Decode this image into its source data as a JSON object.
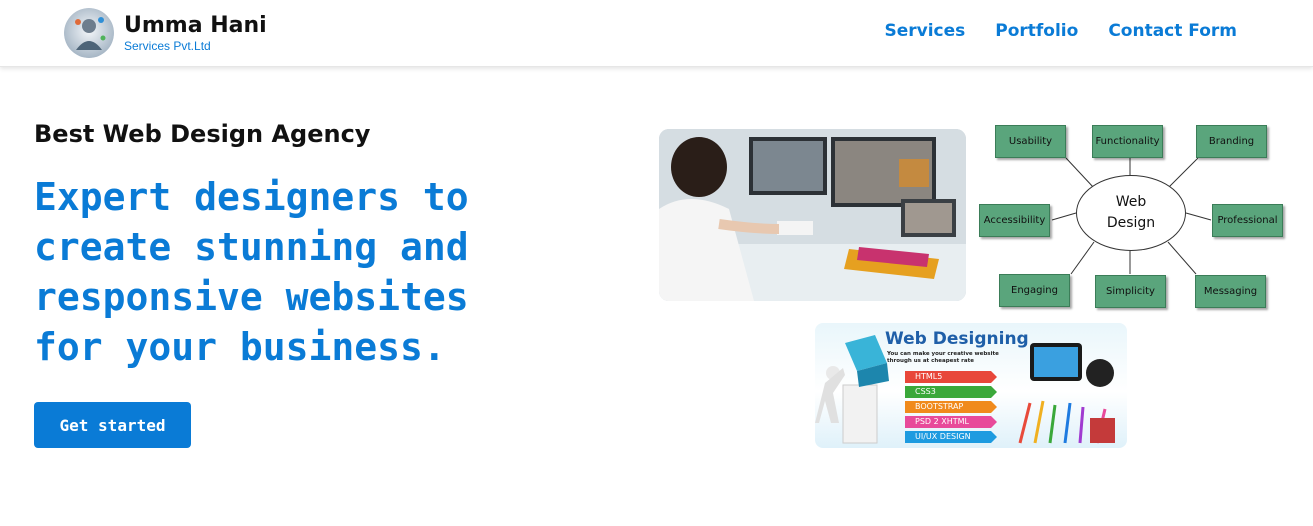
{
  "header": {
    "brand_name": "Umma Hani",
    "brand_sub": "Services Pvt.Ltd",
    "nav": [
      "Services",
      "Portfolio",
      "Contact Form"
    ]
  },
  "hero": {
    "kicker": "Best Web Design Agency",
    "title_lines": [
      "Expert designers to",
      "create stunning and",
      "responsive websites",
      "for your business."
    ],
    "cta_label": "Get started"
  },
  "diagram": {
    "center_lines": [
      "Web",
      "Design"
    ],
    "nodes": [
      "Usability",
      "Functionality",
      "Branding",
      "Accessibility",
      "Professional",
      "Engaging",
      "Simplicity",
      "Messaging"
    ]
  },
  "banner": {
    "title": "Web Designing",
    "subtitle": "You can make your creative website through us at cheapest rate",
    "tags": [
      {
        "label": "HTML5",
        "color": "#e8473a"
      },
      {
        "label": "CSS3",
        "color": "#3aa83a"
      },
      {
        "label": "BOOTSTRAP",
        "color": "#f08a1c"
      },
      {
        "label": "PSD 2 XHTML",
        "color": "#e84a9a"
      },
      {
        "label": "UI/UX DESIGN",
        "color": "#1e9be0"
      }
    ]
  },
  "colors": {
    "accent": "#0a7bd6",
    "node_green": "#5aa57c"
  }
}
